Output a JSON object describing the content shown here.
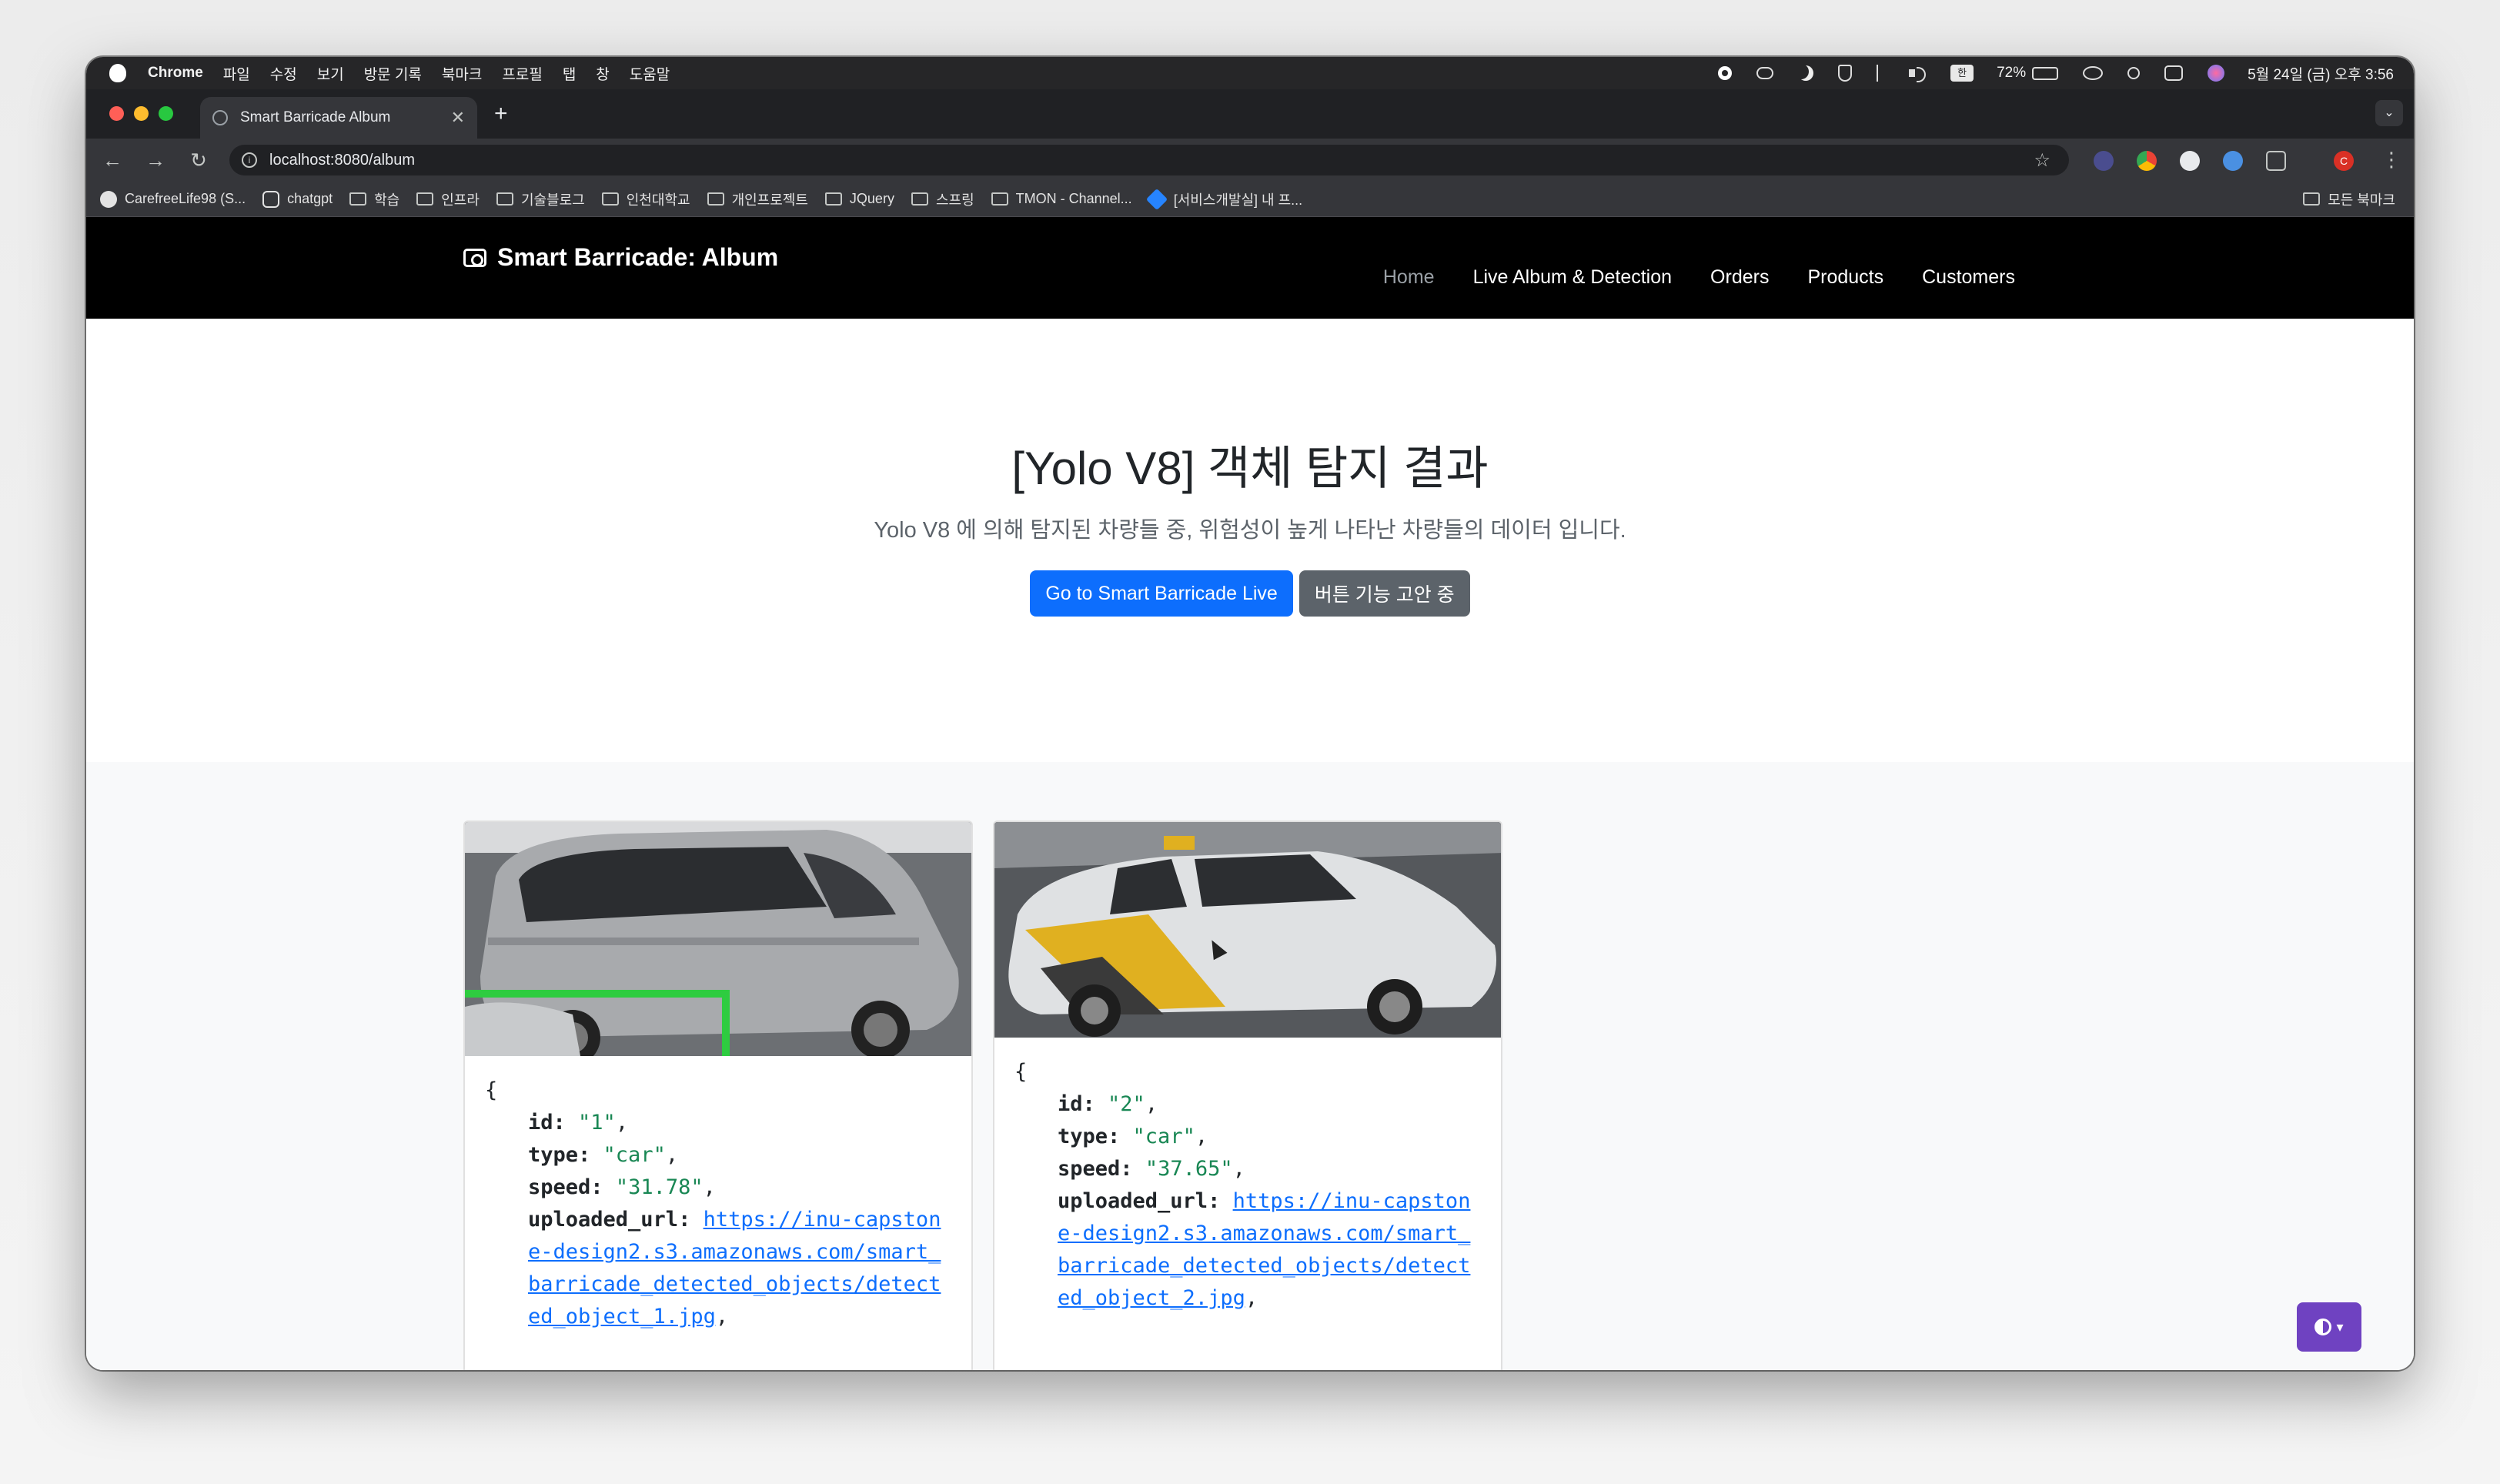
{
  "menubar": {
    "app": "Chrome",
    "items": [
      "파일",
      "수정",
      "보기",
      "방문 기록",
      "북마크",
      "프로필",
      "탭",
      "창",
      "도움말"
    ],
    "battery_percent": "72%",
    "battery_level": 0.72,
    "kbd_label": "한",
    "clock": "5월 24일 (금) 오후 3:56"
  },
  "browser": {
    "tab_title": "Smart Barricade Album",
    "url": "localhost:8080/album",
    "profile_initial": "C",
    "bookmarks": [
      "CarefreeLife98 (S...",
      "chatgpt",
      "학습",
      "인프라",
      "기술블로그",
      "인천대학교",
      "개인프로젝트",
      "JQuery",
      "스프링",
      "TMON - Channel...",
      "[서비스개발실] 내 프...",
      "모든 북마크"
    ]
  },
  "nav": {
    "brand": "Smart Barricade: Album",
    "links": [
      "Home",
      "Live Album & Detection",
      "Orders",
      "Products",
      "Customers"
    ]
  },
  "hero": {
    "title": "[Yolo V8] 객체 탐지 결과",
    "subtitle": "Yolo V8 에 의해 탐지된 차량들 중, 위험성이 높게 나타난 차량들의 데이터 입니다.",
    "primary_button": "Go to Smart Barricade Live",
    "secondary_button": "버튼 기능 고안 중"
  },
  "cards": [
    {
      "open": "{",
      "id_key": "id:",
      "id": "\"1\"",
      "type_key": "type:",
      "type": "\"car\"",
      "speed_key": "speed:",
      "speed": "\"31.78\"",
      "url_key": "uploaded_url:",
      "url": "https://inu-capstone-design2.s3.amazonaws.com/smart_barricade_detected_objects/detected_object_1.jpg"
    },
    {
      "open": "{",
      "id_key": "id:",
      "id": "\"2\"",
      "type_key": "type:",
      "type": "\"car\"",
      "speed_key": "speed:",
      "speed": "\"37.65\"",
      "url_key": "uploaded_url:",
      "url": "https://inu-capstone-design2.s3.amazonaws.com/smart_barricade_detected_objects/detected_object_2.jpg"
    }
  ],
  "colors": {
    "primary": "#0d6efd",
    "secondary": "#5c636a",
    "string_green": "#198754",
    "navbar": "#000000",
    "theme_toggle": "#6f42c1"
  }
}
